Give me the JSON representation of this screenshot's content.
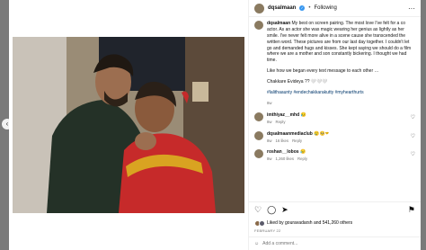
{
  "post": {
    "username": "dqsalmaan",
    "follow_state": "Following",
    "caption_paragraphs": [
      "My best on screen pairing. The most love I've felt for a co actor. As an actor she was magic wearing her genius as lightly as her smile. I've never felt more alive in a scene cause she transcended the written word. These pictures are from our last day together. I couldn't let go and demanded hugs and kisses. She kept saying we should do a film where we are a mother and son constantly bickering. I thought we had time.",
      "Like how we began every text message to each other …",
      "Chakkare Evideya ?? 🤍🤍🤍"
    ],
    "hashtags": "#lalithaaunty #endechakkarakutty #myhearthurts",
    "caption_age": "8w",
    "likes_text": "Liked by gouravadarsh and 541,260 others",
    "date": "FEBRUARY 22"
  },
  "comments": [
    {
      "user": "imthiyaz__mhd",
      "text": "😥",
      "age": "8w",
      "likes": "",
      "reply": "Reply"
    },
    {
      "user": "dqsalmaanmediaclub",
      "text": "😢🥺❤",
      "age": "8w",
      "likes": "16 likes",
      "reply": "Reply"
    },
    {
      "user": "roshan__lobos",
      "text": "😥",
      "age": "8w",
      "likes": "1,260 likes",
      "reply": "Reply"
    }
  ],
  "add_comment_placeholder": "Add a comment...",
  "icons": [
    "close-icon",
    "chevron-left-icon",
    "verified-icon",
    "more-options-icon",
    "heart-icon",
    "comment-icon",
    "share-icon",
    "bookmark-icon",
    "emoji-icon"
  ],
  "colors": {
    "accent_blue": "#3897f0",
    "hashtag": "#00376b",
    "muted": "#737373"
  }
}
